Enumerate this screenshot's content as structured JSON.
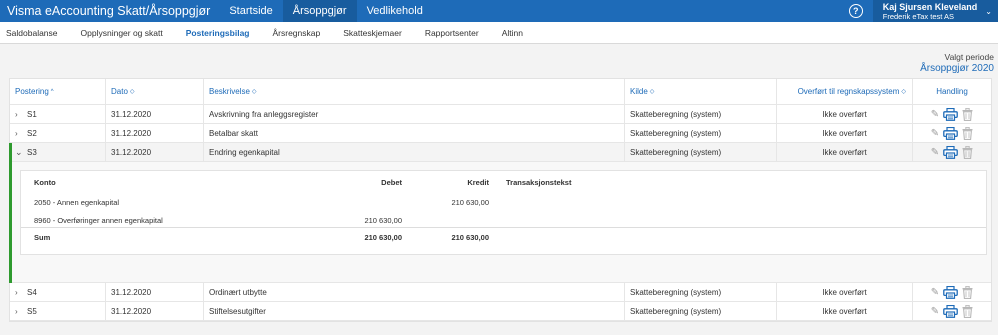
{
  "header": {
    "app_title": "Visma eAccounting Skatt/Årsoppgjør",
    "nav": [
      "Startside",
      "Årsoppgjør",
      "Vedlikehold"
    ],
    "active_nav": 1,
    "help_label": "?",
    "user_name": "Kaj Sjursen Kleveland",
    "company": "Frederik eTax test AS",
    "user_chevron": "⌄"
  },
  "subnav": {
    "items": [
      "Saldobalanse",
      "Opplysninger og skatt",
      "Posteringsbilag",
      "Årsregnskap",
      "Skatteskjemaer",
      "Rapportsenter",
      "Altinn"
    ],
    "active": 2
  },
  "period": {
    "label": "Valgt periode",
    "value": "Årsoppgjør 2020"
  },
  "table": {
    "columns": {
      "postering": "Postering",
      "dato": "Dato",
      "beskrivelse": "Beskrivelse",
      "kilde": "Kilde",
      "overfort": "Overført til regnskapssystem",
      "handling": "Handling"
    },
    "sort_asc": "^",
    "sort_both": "◇",
    "rows": [
      {
        "id": "S1",
        "date": "31.12.2020",
        "description": "Avskrivning fra anleggsregister",
        "source": "Skatteberegning (system)",
        "transferred": "Ikke overført",
        "expanded": false
      },
      {
        "id": "S2",
        "date": "31.12.2020",
        "description": "Betalbar skatt",
        "source": "Skatteberegning (system)",
        "transferred": "Ikke overført",
        "expanded": false
      },
      {
        "id": "S3",
        "date": "31.12.2020",
        "description": "Endring egenkapital",
        "source": "Skatteberegning (system)",
        "transferred": "Ikke overført",
        "expanded": true
      },
      {
        "id": "S4",
        "date": "31.12.2020",
        "description": "Ordinært utbytte",
        "source": "Skatteberegning (system)",
        "transferred": "Ikke overført",
        "expanded": false
      },
      {
        "id": "S5",
        "date": "31.12.2020",
        "description": "Stiftelsesutgifter",
        "source": "Skatteberegning (system)",
        "transferred": "Ikke overført",
        "expanded": false
      }
    ]
  },
  "detail": {
    "columns": {
      "konto": "Konto",
      "debet": "Debet",
      "kredit": "Kredit",
      "tekst": "Transaksjonstekst"
    },
    "lines": [
      {
        "konto": "2050 - Annen egenkapital",
        "debet": "",
        "kredit": "210 630,00"
      },
      {
        "konto": "8960 - Overføringer annen egenkapital",
        "debet": "210 630,00",
        "kredit": ""
      }
    ],
    "sum": {
      "label": "Sum",
      "debet": "210 630,00",
      "kredit": "210 630,00"
    }
  },
  "colors": {
    "brand": "#1e6bb8",
    "active_nav": "#185c9e",
    "expanded_bar": "#2e9a2e"
  },
  "icons": {
    "edit": "pencil-icon",
    "print": "printer-icon",
    "delete": "trash-icon",
    "collapsed": "chevron-right-icon",
    "expanded": "chevron-down-icon"
  }
}
